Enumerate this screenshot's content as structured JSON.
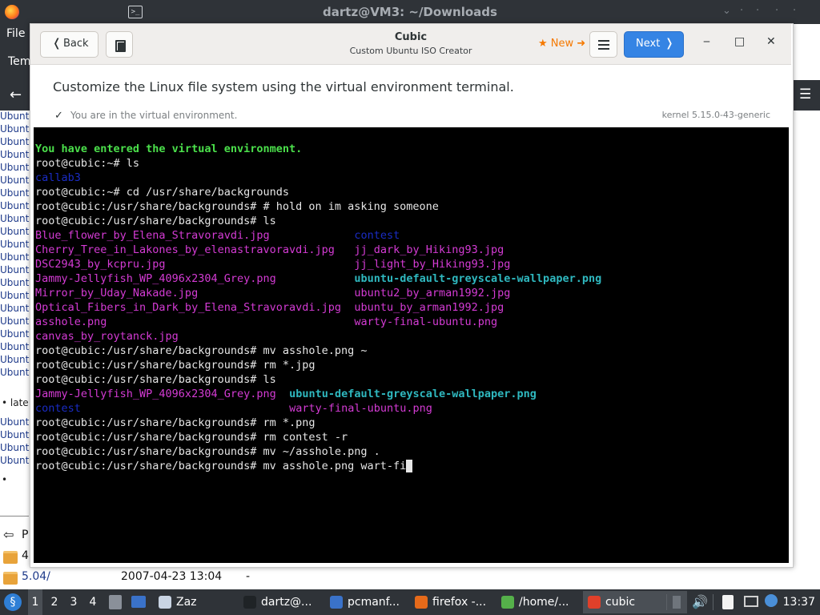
{
  "bg_window": {
    "title": "dartz@VM3: ~/Downloads",
    "menu_file": "File",
    "tab_label": "Tem",
    "back_arrow": "←",
    "hamburger": "☰",
    "list_items": [
      "Ubunt",
      "Ubunt",
      "Ubunt",
      "Ubunt",
      "Ubunt",
      "Ubunt",
      "Ubunt",
      "Ubunt",
      "Ubunt",
      "Ubunt",
      "Ubunt",
      "Ubunt",
      "Ubunt",
      "Ubunt",
      "Ubunt",
      "Ubunt",
      "Ubunt",
      "Ubunt",
      "Ubunt",
      "Ubunt",
      "Ubunt"
    ],
    "bullet_late": "• late",
    "list_items_2": [
      "Ubunt",
      "Ubunt",
      "Ubunt",
      "Ubunt"
    ],
    "bullet_empty": "•",
    "bottom_rows": [
      {
        "name": "P",
        "date": "",
        "size": ""
      },
      {
        "name": "4",
        "date": "",
        "size": ""
      },
      {
        "name": "5.04/",
        "date": "2007-04-23 13:04",
        "size": "-"
      }
    ]
  },
  "cubic": {
    "back_label": "Back",
    "back_chevron": "❬",
    "title": "Cubic",
    "subtitle": "Custom Ubuntu ISO Creator",
    "new_label": "★ New ➜",
    "next_label": "Next",
    "next_chevron": "❭",
    "minimize": "‒",
    "maximize": "□",
    "close": "✕",
    "heading": "Customize the Linux file system using the virtual environment terminal.",
    "env_status": "You are in the virtual environment.",
    "kernel": "kernel 5.15.0-43-generic"
  },
  "terminal": {
    "lines": [
      [
        {
          "t": "You have entered the virtual environment.",
          "c": "green"
        }
      ],
      [
        {
          "t": "root@cubic:~# ls"
        }
      ],
      [
        {
          "t": "callab3",
          "c": "blue"
        }
      ],
      [
        {
          "t": "root@cubic:~# cd /usr/share/backgrounds"
        }
      ],
      [
        {
          "t": "root@cubic:/usr/share/backgrounds# # hold on im asking someone"
        }
      ],
      [
        {
          "t": "root@cubic:/usr/share/backgrounds# ls"
        }
      ],
      [
        {
          "t": "Blue_flower_by_Elena_Stravoravdi.jpg",
          "c": "mag"
        },
        {
          "t": "contest",
          "c": "blue",
          "col": 49
        }
      ],
      [
        {
          "t": "Cherry_Tree_in_Lakones_by_elenastravoravdi.jpg",
          "c": "mag"
        },
        {
          "t": "jj_dark_by_Hiking93.jpg",
          "c": "mag",
          "col": 49
        }
      ],
      [
        {
          "t": "DSC2943_by_kcpru.jpg",
          "c": "mag"
        },
        {
          "t": "jj_light_by_Hiking93.jpg",
          "c": "mag",
          "col": 49
        }
      ],
      [
        {
          "t": "Jammy-Jellyfish_WP_4096x2304_Grey.png",
          "c": "mag"
        },
        {
          "t": "ubuntu-default-greyscale-wallpaper.png",
          "c": "cyan",
          "col": 49
        }
      ],
      [
        {
          "t": "Mirror_by_Uday_Nakade.jpg",
          "c": "mag"
        },
        {
          "t": "ubuntu2_by_arman1992.jpg",
          "c": "mag",
          "col": 49
        }
      ],
      [
        {
          "t": "Optical_Fibers_in_Dark_by_Elena_Stravoravdi.jpg",
          "c": "mag"
        },
        {
          "t": "ubuntu_by_arman1992.jpg",
          "c": "mag",
          "col": 49
        }
      ],
      [
        {
          "t": "asshole.png",
          "c": "mag"
        },
        {
          "t": "warty-final-ubuntu.png",
          "c": "mag",
          "col": 49
        }
      ],
      [
        {
          "t": "canvas_by_roytanck.jpg",
          "c": "mag"
        }
      ],
      [
        {
          "t": "root@cubic:/usr/share/backgrounds# mv asshole.png ~"
        }
      ],
      [
        {
          "t": "root@cubic:/usr/share/backgrounds# rm *.jpg"
        }
      ],
      [
        {
          "t": "root@cubic:/usr/share/backgrounds# ls"
        }
      ],
      [
        {
          "t": "Jammy-Jellyfish_WP_4096x2304_Grey.png",
          "c": "mag"
        },
        {
          "t": "ubuntu-default-greyscale-wallpaper.png",
          "c": "cyan",
          "col": 39
        }
      ],
      [
        {
          "t": "contest",
          "c": "blue"
        },
        {
          "t": "warty-final-ubuntu.png",
          "c": "mag",
          "col": 39
        }
      ],
      [
        {
          "t": "root@cubic:/usr/share/backgrounds# rm *.png"
        }
      ],
      [
        {
          "t": "root@cubic:/usr/share/backgrounds# rm contest -r"
        }
      ],
      [
        {
          "t": "root@cubic:/usr/share/backgrounds# mv ~/asshole.png ."
        }
      ],
      [
        {
          "t": "root@cubic:/usr/share/backgrounds# mv asshole.png wart-fi",
          "cursor": true
        }
      ]
    ]
  },
  "taskbar": {
    "workspaces": [
      "1",
      "2",
      "3",
      "4"
    ],
    "tasks": [
      {
        "label": "Zaz",
        "icon_color": "#c9d4e3"
      },
      {
        "label": "dartz@...",
        "icon_color": "#1f2326"
      },
      {
        "label": "pcmanf...",
        "icon_color": "#3a72c9"
      },
      {
        "label": "firefox -...",
        "icon_color": "#e66a1a"
      },
      {
        "label": "/home/...",
        "icon_color": "#55b04a"
      },
      {
        "label": "cubic",
        "icon_color": "#e0402a"
      }
    ],
    "clock": "13:37"
  }
}
